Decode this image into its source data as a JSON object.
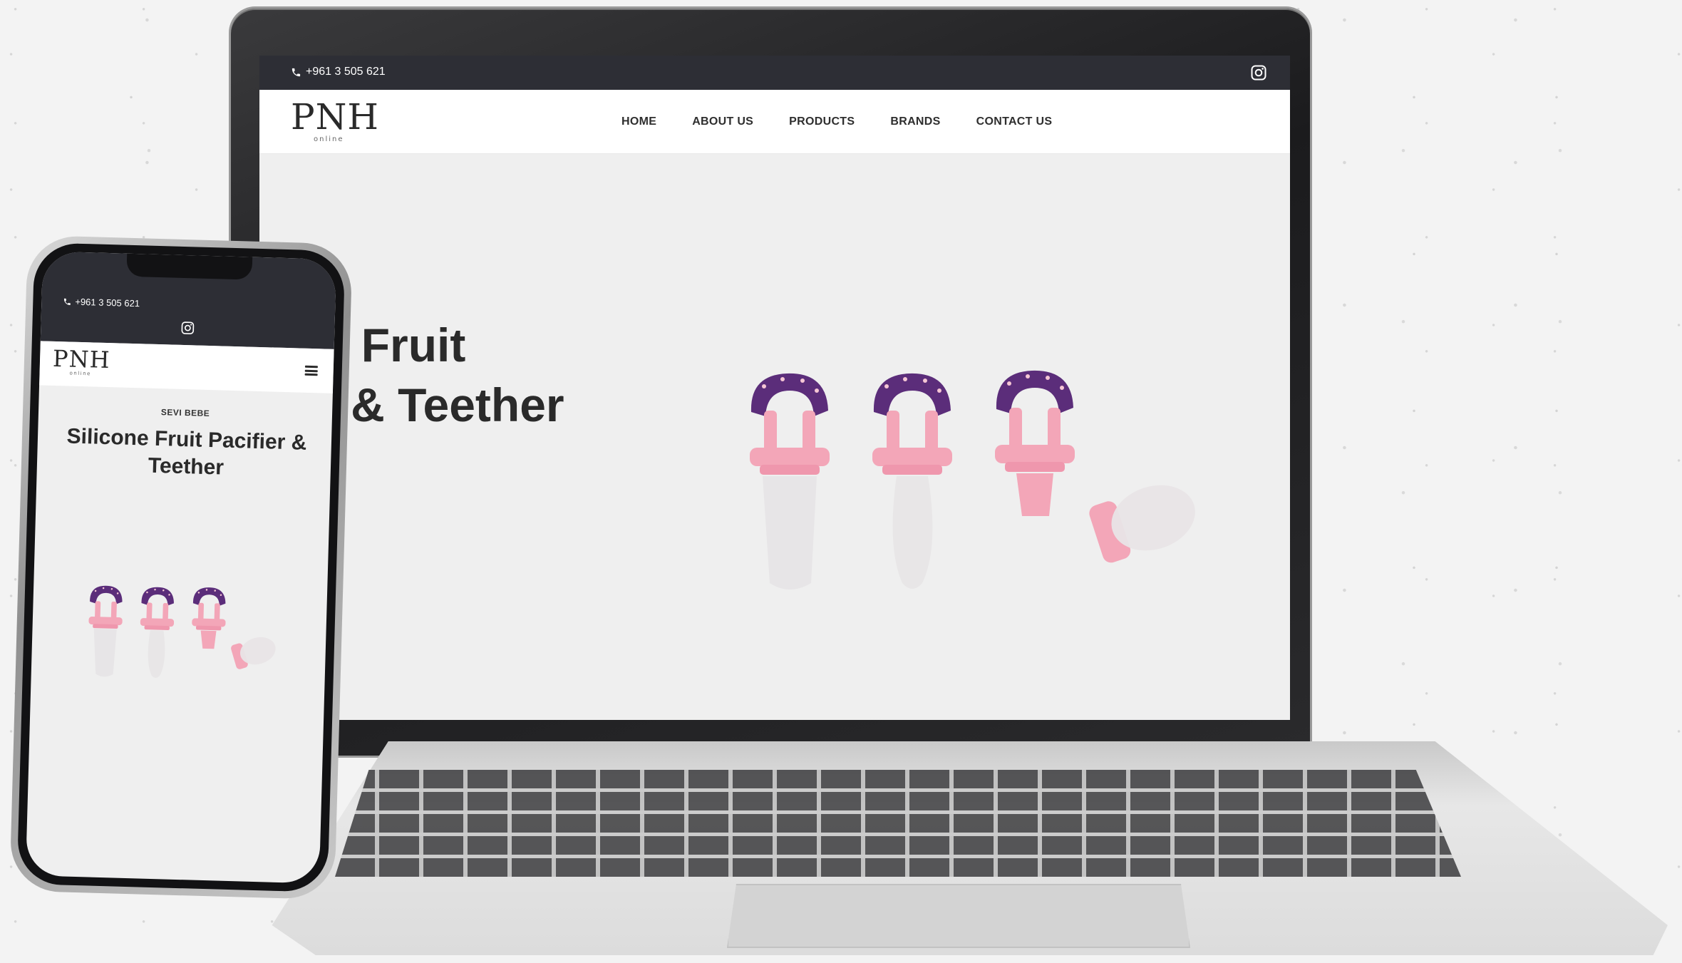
{
  "desktop": {
    "topbar": {
      "phone": "+961 3 505 621",
      "instagram_icon": "instagram-icon"
    },
    "logo": {
      "mark": "PNH",
      "sub": "online"
    },
    "nav": [
      "HOME",
      "ABOUT US",
      "PRODUCTS",
      "BRANDS",
      "CONTACT US"
    ],
    "hero": {
      "title_line1": "icone Fruit",
      "title_line2": "cifier & Teether"
    }
  },
  "mobile": {
    "topbar": {
      "phone": "+961 3 505 621",
      "instagram_icon": "instagram-icon"
    },
    "logo": {
      "mark": "PNH",
      "sub": "online"
    },
    "menu_icon": "hamburger-menu-icon",
    "brand": "SEVI BEBE",
    "title": "Silicone Fruit Pacifier & Teether"
  },
  "colors": {
    "topbar": "#2d2e35",
    "hero_bg": "#efefef",
    "product_purple": "#5b2d7a",
    "product_pink": "#f3a6b8"
  }
}
